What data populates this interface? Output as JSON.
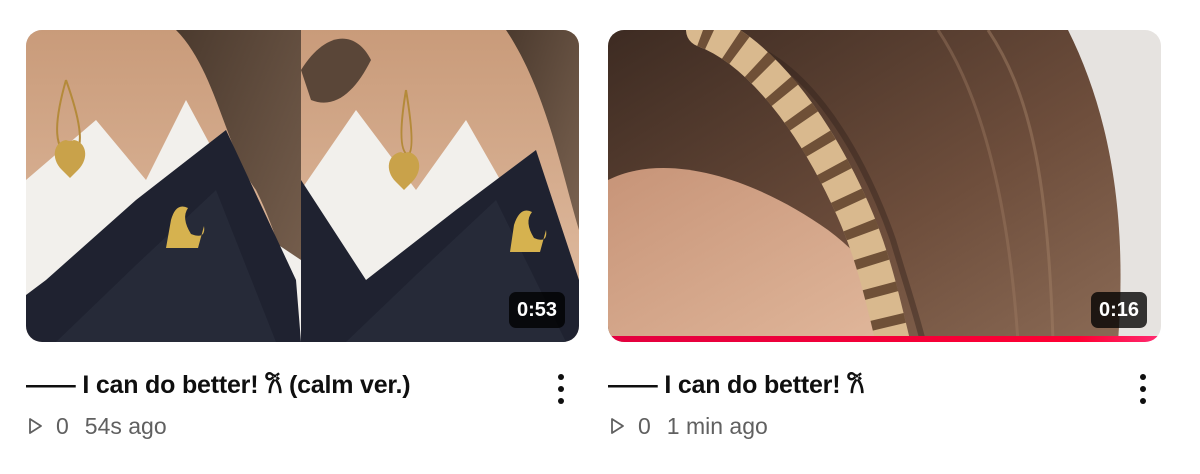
{
  "videos": [
    {
      "duration": "0:53",
      "title": "—— I can do better! 𐙚 (calm ver.)",
      "views": "0",
      "age": "54s ago",
      "progress": 0,
      "thumbnail_icon": "necklace-swan-brooch-image"
    },
    {
      "duration": "0:16",
      "title": "—— I can do better! 𐙚",
      "views": "0",
      "age": "1 min ago",
      "progress": 1.0,
      "thumbnail_icon": "tortoiseshell-headband-image"
    }
  ],
  "colors": {
    "progress": "#ff0033",
    "text_primary": "#0f0f0f",
    "text_secondary": "#606060"
  }
}
